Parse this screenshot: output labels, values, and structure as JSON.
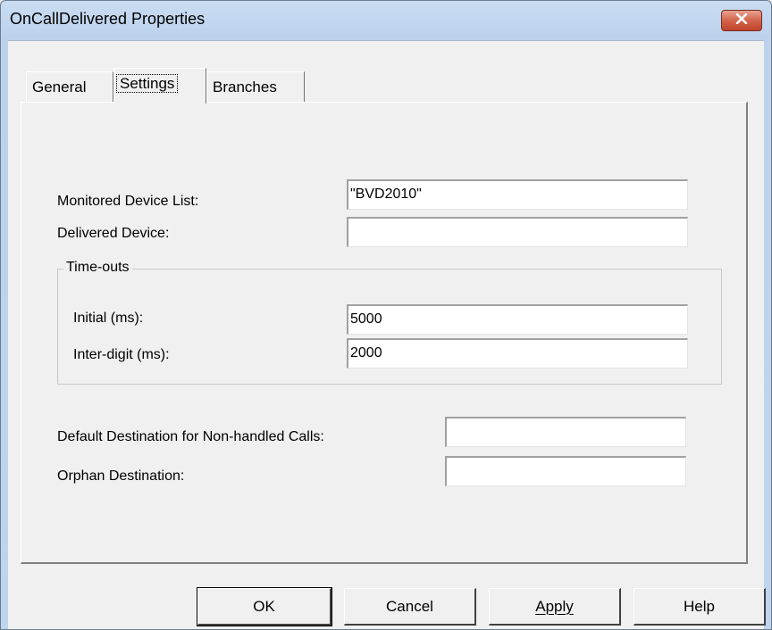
{
  "window": {
    "title": "OnCallDelivered Properties"
  },
  "tabs": [
    {
      "label": "General"
    },
    {
      "label": "Settings"
    },
    {
      "label": "Branches"
    }
  ],
  "settings": {
    "monitored_device_list_label": "Monitored Device List:",
    "monitored_device_list_value": "\"BVD2010\"",
    "delivered_device_label": "Delivered Device:",
    "delivered_device_value": "",
    "timeouts": {
      "group_label": "Time-outs",
      "initial_label": "Initial (ms):",
      "initial_value": "5000",
      "inter_digit_label": "Inter-digit (ms):",
      "inter_digit_value": "2000"
    },
    "default_destination_label": "Default Destination for Non-handled Calls:",
    "default_destination_value": "",
    "orphan_destination_label": "Orphan Destination:",
    "orphan_destination_value": ""
  },
  "buttons": {
    "ok": "OK",
    "cancel": "Cancel",
    "apply": "Apply",
    "help": "Help"
  },
  "icons": {
    "close": "close-icon"
  },
  "colors": {
    "close_button": "#c8452f",
    "titlebar": "#bfd4ed"
  }
}
